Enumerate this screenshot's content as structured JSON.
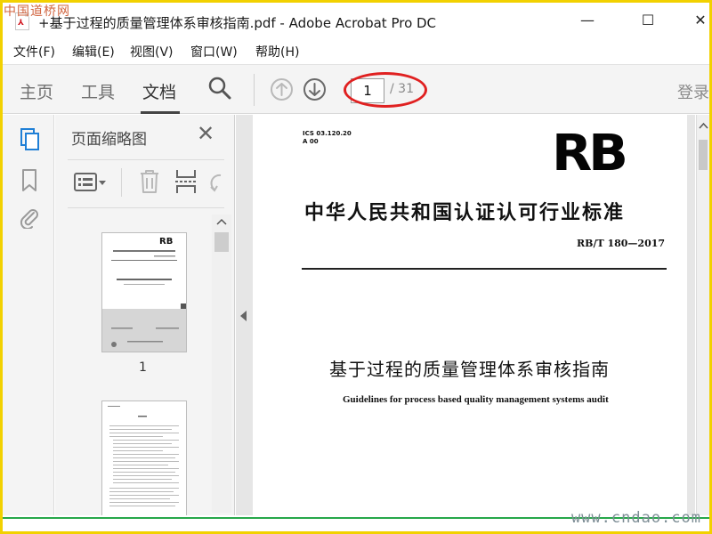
{
  "window": {
    "title": "+基于过程的质量管理体系审核指南.pdf - Adobe Acrobat Pro DC",
    "minimize_glyph": "—",
    "maximize_glyph": "☐",
    "close_glyph": "✕"
  },
  "watermarks": {
    "top_left": "中国道桥网",
    "bottom_right": "www.cndao.com"
  },
  "menu": {
    "items": [
      "文件(F)",
      "编辑(E)",
      "视图(V)",
      "窗口(W)",
      "帮助(H)"
    ]
  },
  "toolbar": {
    "tabs": [
      "主页",
      "工具",
      "文档"
    ],
    "active_tab": "文档",
    "current_page": "1",
    "total_pages": "/ 31",
    "login": "登录",
    "icons": [
      "search-icon",
      "page-up-icon",
      "page-down-icon"
    ]
  },
  "sidebar": {
    "rail_icons": [
      "page-thumbnails-icon",
      "bookmark-icon",
      "attachment-icon"
    ],
    "panel_title": "页面缩略图",
    "close_glyph": "✕",
    "tool_icons": [
      "thumbnail-options-icon",
      "delete-page-icon",
      "insert-page-icon",
      "rotate-icon"
    ],
    "thumbnail_1_label": "1"
  },
  "document": {
    "ics_code": "ICS 03.120.20\nA 00",
    "logo": "RB",
    "standard_title": "中华人民共和国认证认可行业标准",
    "standard_number": "RB/T 180—2017",
    "title_cn": "基于过程的质量管理体系审核指南",
    "title_en": "Guidelines for process based quality management systems audit"
  },
  "colors": {
    "frame": "#f2d100",
    "highlight_oval": "#e02020",
    "status_line": "#27a84a"
  }
}
